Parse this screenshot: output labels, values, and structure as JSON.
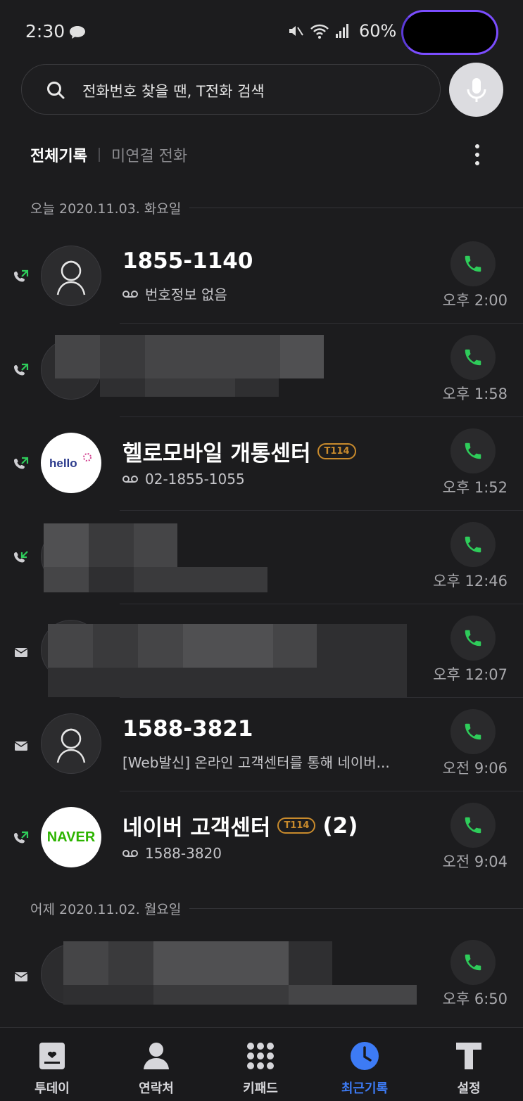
{
  "status": {
    "time": "2:30",
    "battery": "60%"
  },
  "search": {
    "placeholder": "전화번호 찾을 땐, T전화 검색"
  },
  "tabs": {
    "all": "전체기록",
    "missed": "미연결 전화"
  },
  "sections": {
    "today": "오늘 2020.11.03. 화요일",
    "yesterday": "어제 2020.11.02. 월요일"
  },
  "calls": [
    {
      "name": "1855-1140",
      "sub": "번호정보 없음",
      "time": "오후 2:00",
      "type": "outgoing"
    },
    {
      "name": "",
      "sub": "",
      "time": "오후 1:58",
      "type": "outgoing"
    },
    {
      "name": "헬로모바일 개통센터",
      "badge": "T114",
      "sub": "02-1855-1055",
      "time": "오후 1:52",
      "type": "outgoing",
      "logo": "hello"
    },
    {
      "name": "",
      "sub": "",
      "time": "오후 12:46",
      "type": "incoming"
    },
    {
      "name": "",
      "sub": "",
      "time": "오후 12:07",
      "type": "message"
    },
    {
      "name": "1588-3821",
      "sub": "[Web발신] 온라인 고객센터를 통해 네이버...",
      "time": "오전 9:06",
      "type": "message"
    },
    {
      "name": "네이버 고객센터",
      "badge": "T114",
      "count": "(2)",
      "sub": "1588-3820",
      "time": "오전 9:04",
      "type": "outgoing",
      "logo": "NAVER"
    },
    {
      "name": "",
      "sub": "",
      "time": "오후 6:50",
      "type": "message"
    }
  ],
  "nav": [
    {
      "label": "투데이",
      "icon": "today-icon"
    },
    {
      "label": "연락처",
      "icon": "contacts-icon"
    },
    {
      "label": "키패드",
      "icon": "keypad-icon"
    },
    {
      "label": "최근기록",
      "icon": "clock-icon",
      "active": true
    },
    {
      "label": "설정",
      "icon": "settings-t-icon"
    }
  ],
  "colors": {
    "accent_green": "#2ecc5a",
    "active_blue": "#3d7bf5",
    "badge_orange": "#c88a2c"
  }
}
